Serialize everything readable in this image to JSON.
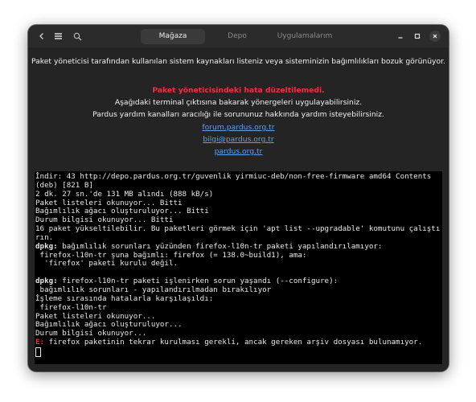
{
  "header": {
    "tabs": [
      {
        "label": "Mağaza",
        "active": true
      },
      {
        "label": "Depo",
        "active": false
      },
      {
        "label": "Uygulamalarım",
        "active": false
      }
    ],
    "icons": [
      "back-icon",
      "menu-icon",
      "search-icon",
      "minimize-icon",
      "maximize-icon",
      "close-icon"
    ]
  },
  "message": {
    "summary": "Paket yöneticisi tarafından kullanılan sistem kaynakları listeniz veya sisteminizin bağımlılıkları bozuk görünüyor.",
    "error_title": "Paket yöneticisindeki hata düzeltilemedi.",
    "line1": "Aşağıdaki terminal çıktısına bakarak yönergeleri uygulayabilirsiniz.",
    "line2": "Pardus yardım kanalları aracılığı ile sorununuz hakkında yardım isteyebilirsiniz.",
    "links": [
      "forum.pardus.org.tr",
      "bilgi@pardus.org.tr",
      "pardus.org.tr"
    ]
  },
  "terminal": {
    "lines": [
      {
        "text": "İndir: 43 http://depo.pardus.org.tr/guvenlik yirmiuc-deb/non-free-firmware amd64 Contents (deb) [821 B]"
      },
      {
        "text": "2 dk. 27 sn.'de 131 MB alındı (888 kB/s)"
      },
      {
        "text": "Paket listeleri okunuyor... Bitti"
      },
      {
        "text": "Bağımlılık ağacı oluşturuluyor... Bitti"
      },
      {
        "text": "Durum bilgisi okunuyor... Bitti"
      },
      {
        "text": "16 paket yükseltilebilir. Bu paketleri görmek için 'apt list --upgradable' komutunu çalıştırın."
      },
      {
        "prefix": "dpkg:",
        "prefix_style": "bold",
        "text": " bağımlılık sorunları yüzünden firefox-l10n-tr paketi yapılandırılamıyor:"
      },
      {
        "text": " firefox-l10n-tr şuna bağımlı: firefox (= 138.0~build1), ama:"
      },
      {
        "text": "  'firefox' paketi kurulu değil."
      },
      {
        "text": ""
      },
      {
        "prefix": "dpkg:",
        "prefix_style": "bold",
        "text": " firefox-l10n-tr paketi işlenirken sorun yaşandı (--configure):"
      },
      {
        "text": " bağımlılık sorunları - yapılandırılmadan bırakılıyor"
      },
      {
        "text": "İşleme sırasında hatalarla karşılaşıldı:"
      },
      {
        "text": " firefox-l10n-tr"
      },
      {
        "text": "Paket listeleri okunuyor..."
      },
      {
        "text": "Bağımlılık ağacı oluşturuluyor..."
      },
      {
        "text": "Durum bilgisi okunuyor..."
      },
      {
        "prefix": "E:",
        "prefix_style": "error",
        "text": " firefox paketinin tekrar kurulması gerekli, ancak gereken arşiv dosyası bulunamıyor."
      }
    ]
  },
  "colors": {
    "window_bg": "#242424",
    "header_bg": "#2b2b2b",
    "terminal_bg": "#000000",
    "error": "#ed333b",
    "link": "#62a0ea"
  }
}
